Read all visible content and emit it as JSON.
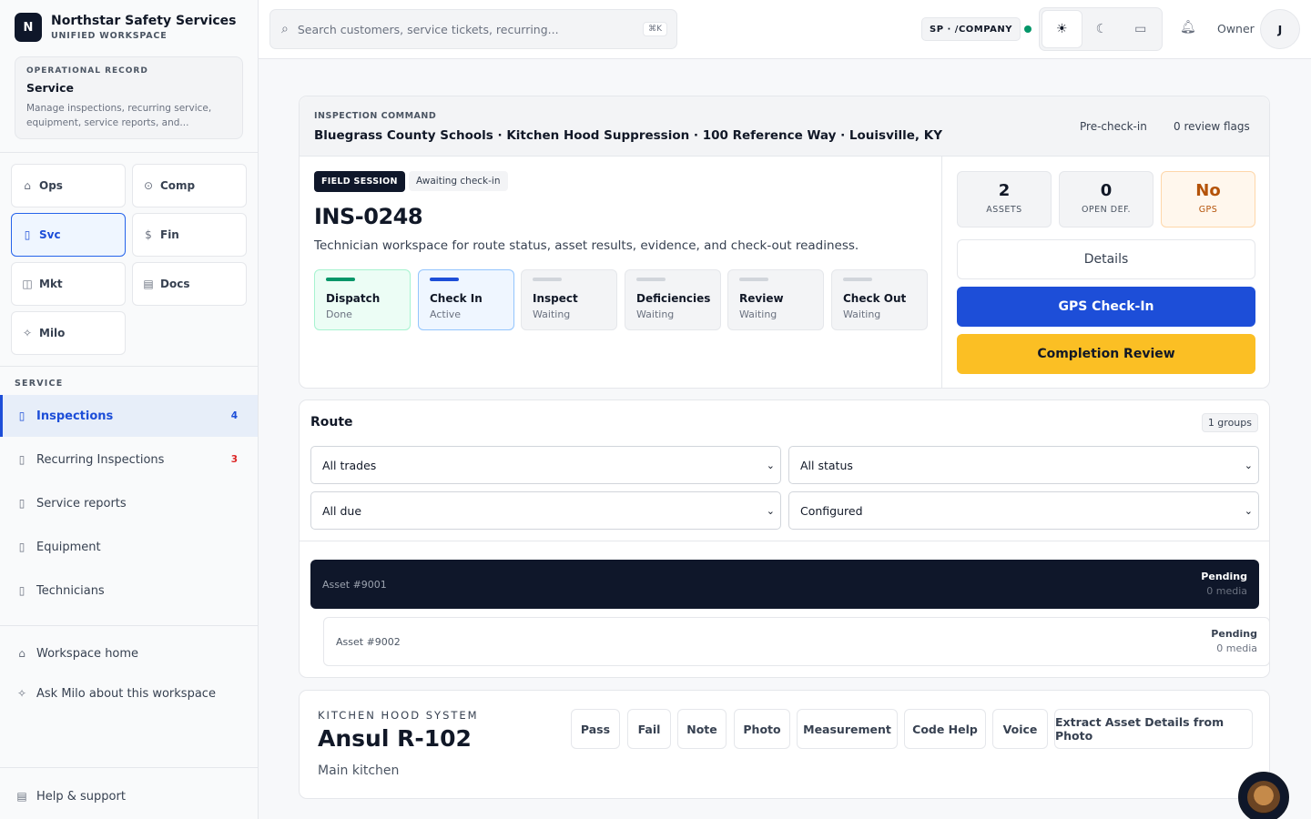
{
  "brand": {
    "logo": "N",
    "title": "Northstar Safety Services",
    "subtitle": "UNIFIED WORKSPACE"
  },
  "operational_record": {
    "eyebrow": "OPERATIONAL RECORD",
    "title": "Service",
    "description": "Manage inspections, recurring service, equipment, service reports, and..."
  },
  "modules": [
    {
      "label": "Ops",
      "icon": "home-icon"
    },
    {
      "label": "Comp",
      "icon": "check-circle-icon"
    },
    {
      "label": "Svc",
      "icon": "clipboard-icon",
      "active": true
    },
    {
      "label": "Fin",
      "icon": "dollar-icon"
    },
    {
      "label": "Mkt",
      "icon": "megaphone-icon"
    },
    {
      "label": "Docs",
      "icon": "document-icon"
    },
    {
      "label": "Milo",
      "icon": "sparkle-icon"
    }
  ],
  "service_section": {
    "label": "SERVICE",
    "items": [
      {
        "label": "Inspections",
        "count": "4",
        "active": true
      },
      {
        "label": "Recurring Inspections",
        "count": "3"
      },
      {
        "label": "Service reports"
      },
      {
        "label": "Equipment"
      },
      {
        "label": "Technicians"
      }
    ]
  },
  "footer_nav": {
    "workspace_home": "Workspace home",
    "ask_milo": "Ask Milo about this workspace",
    "help": "Help & support"
  },
  "topbar": {
    "search_placeholder": "Search customers, service tickets, recurring...",
    "shortcut": "⌘K",
    "company": "SP · /COMPANY",
    "status_color": "#059669",
    "owner_label": "Owner",
    "avatar_initial": "J"
  },
  "inspection": {
    "eyebrow": "INSPECTION COMMAND",
    "title": "Bluegrass County Schools · Kitchen Hood Suppression · 100 Reference Way · Louisville, KY",
    "precheck": "Pre-check-in",
    "review_flags": "0 review flags",
    "session_badge": "FIELD SESSION",
    "session_status": "Awaiting check-in",
    "id": "INS-0248",
    "description": "Technician workspace for route status, asset results, evidence, and check-out readiness.",
    "steps": [
      {
        "name": "Dispatch",
        "state": "Done"
      },
      {
        "name": "Check In",
        "state": "Active"
      },
      {
        "name": "Inspect",
        "state": "Waiting"
      },
      {
        "name": "Deficiencies",
        "state": "Waiting"
      },
      {
        "name": "Review",
        "state": "Waiting"
      },
      {
        "name": "Check Out",
        "state": "Waiting"
      }
    ],
    "stats": [
      {
        "value": "2",
        "label": "ASSETS"
      },
      {
        "value": "0",
        "label": "OPEN DEF."
      },
      {
        "value": "No",
        "label": "GPS"
      }
    ],
    "details_label": "Details",
    "gps_checkin_label": "GPS Check-In",
    "completion_label": "Completion Review",
    "colors": {
      "primary": "#1d4ed8",
      "accent": "#fbbf24",
      "done": "#059669",
      "dark": "#0f172a"
    }
  },
  "route": {
    "title": "Route",
    "groups": "1 groups",
    "filters": [
      "All trades",
      "All status",
      "All due",
      "Configured"
    ],
    "assets": [
      {
        "name": "Asset #9001",
        "status": "Pending",
        "media": "0 media",
        "selected": true
      },
      {
        "name": "Asset #9002",
        "status": "Pending",
        "media": "0 media"
      }
    ]
  },
  "equipment": {
    "eyebrow": "KITCHEN HOOD SYSTEM",
    "name": "Ansul R-102",
    "location": "Main kitchen",
    "actions": [
      "Pass",
      "Fail",
      "Note",
      "Photo",
      "Measurement",
      "Code Help",
      "Voice",
      "Extract Asset Details from Photo"
    ]
  }
}
